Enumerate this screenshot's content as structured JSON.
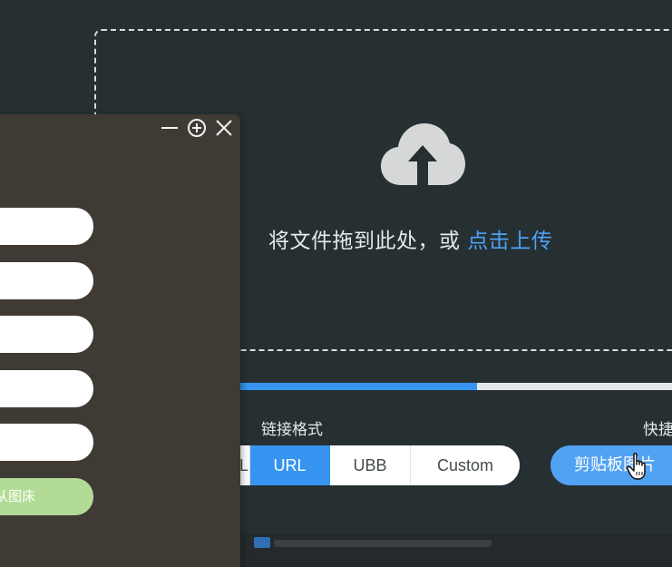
{
  "upload": {
    "drop_text": "将文件拖到此处，或",
    "drop_link": "点击上传",
    "upload_icon": "cloud-upload-icon"
  },
  "progress": {
    "percent": 55
  },
  "link_format": {
    "label": "链接格式",
    "options": [
      "L",
      "URL",
      "UBB",
      "Custom"
    ],
    "selected": "URL"
  },
  "shortcut": {
    "label": "快捷",
    "clipboard_button": "剪贴板图片"
  },
  "panel": {
    "controls": [
      "minimize-icon",
      "add-circle-icon",
      "close-icon"
    ],
    "fields": [
      {
        "value": "",
        "placeholder": ""
      },
      {
        "value": "",
        "placeholder": ""
      },
      {
        "value": "",
        "placeholder": ""
      },
      {
        "value": "",
        "placeholder": ""
      },
      {
        "value": "",
        "placeholder": ""
      }
    ],
    "action_button": "从图床"
  },
  "colors": {
    "accent": "#3794f0",
    "link": "#4ea2f5",
    "panel_bg": "#403a35",
    "window_bg": "#263033",
    "green_button": "#b2dc95"
  }
}
